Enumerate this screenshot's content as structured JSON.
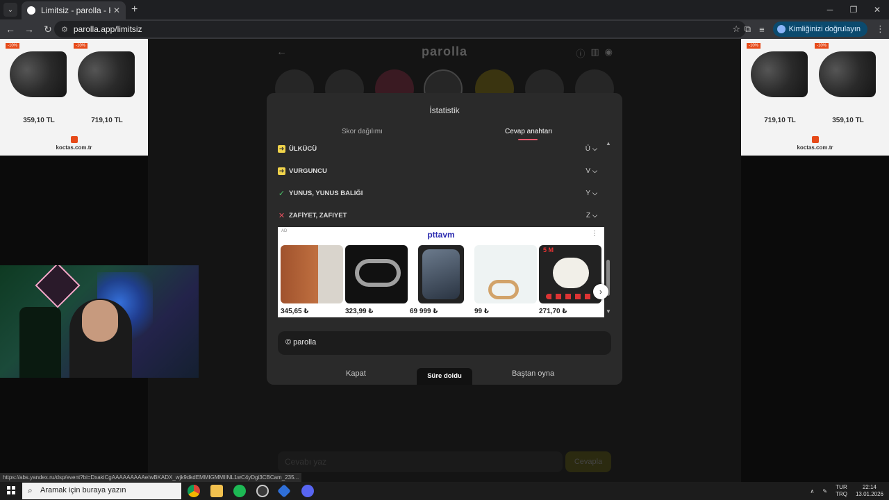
{
  "browser": {
    "tab_title": "Limitsiz - parolla - Kelime oyunu",
    "url": "parolla.app/limitsiz",
    "profile_label": "Kimliğinizi doğrulayın",
    "status_url": "https://abs.yandex.ru/dsp/event?bi=DxakiCgAAAAAAAAAeIwBKADX_wjk9dkdEMMIGMMIINL1wC4yDgi3CBCam_235..."
  },
  "side_ads": {
    "left": {
      "badge": "-10%",
      "prices": [
        "359,10 TL",
        "719,10 TL"
      ],
      "brand": "koctas.com.tr"
    },
    "right": {
      "badge": "-10%",
      "prices": [
        "719,10 TL",
        "359,10 TL"
      ],
      "brand": "koctas.com.tr"
    }
  },
  "game": {
    "logo": "parolla",
    "answer_placeholder": "Cevabı yaz",
    "answer_button": "Cevapla"
  },
  "modal": {
    "title": "İstatistik",
    "tabs": [
      "Skor dağılımı",
      "Cevap anahtarı"
    ],
    "active_tab": "Cevap anahtarı",
    "rows": [
      {
        "status": "pass",
        "word": "ÜLKÜCÜ",
        "letter": "Ü"
      },
      {
        "status": "pass",
        "word": "VURGUNCU",
        "letter": "V"
      },
      {
        "status": "correct",
        "word": "YUNUS, YUNUS BALIĞI",
        "letter": "Y"
      },
      {
        "status": "wrong",
        "word": "ZAFİYET, ZAFIYET",
        "letter": "Z"
      }
    ],
    "ad": {
      "label": "AD",
      "brand": "pttavm",
      "prices": [
        "345,65 ₺",
        "323,99 ₺",
        "69 999 ₺",
        "99 ₺",
        "271,70 ₺"
      ],
      "tag": "5 M"
    },
    "copyright": "© parolla",
    "buttons": {
      "close": "Kapat",
      "timeout": "Süre doldu",
      "restart": "Baştan oyna"
    }
  },
  "taskbar": {
    "search_placeholder": "Aramak için buraya yazın",
    "lang_top": "TUR",
    "lang_bottom": "TRQ",
    "time": "22:14",
    "date": "13.01.2026"
  }
}
